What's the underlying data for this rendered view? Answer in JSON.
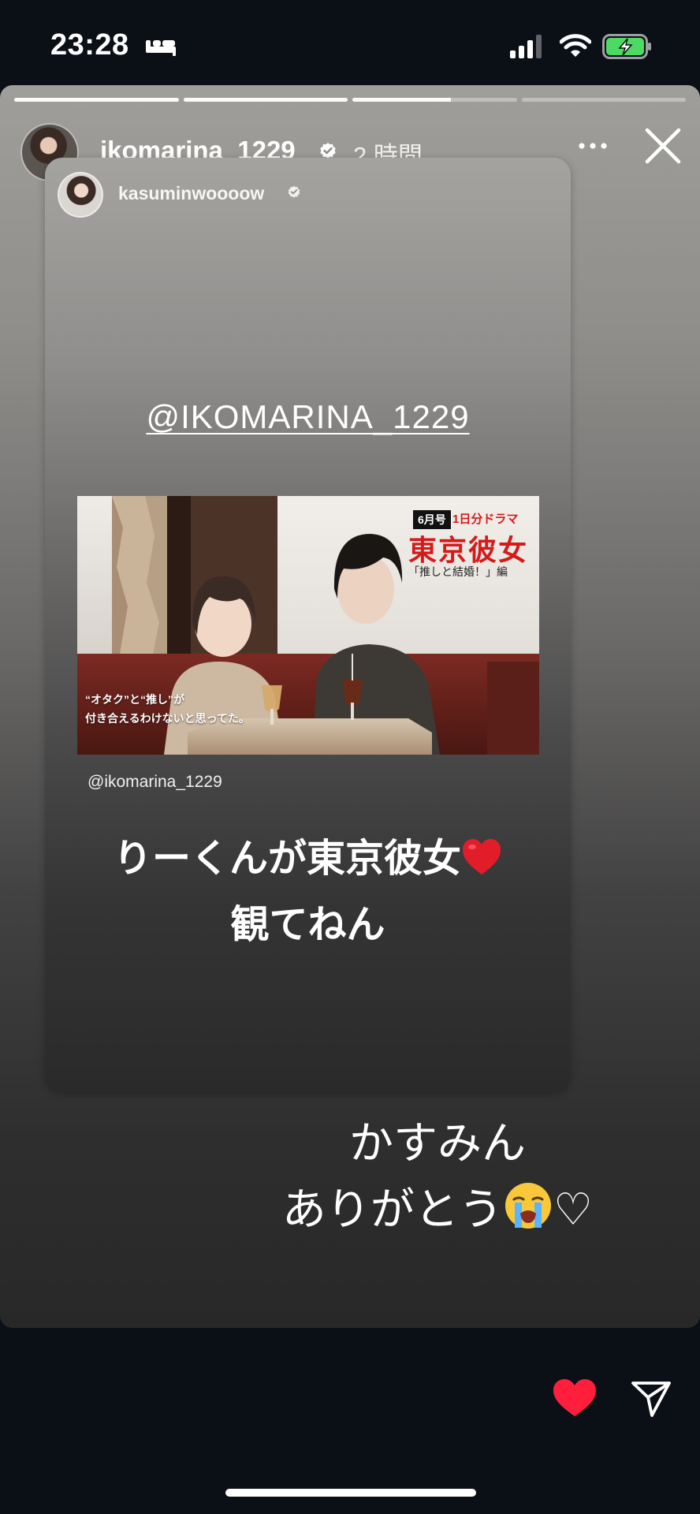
{
  "status_bar": {
    "time": "23:28",
    "sleep_icon": "bed-icon",
    "signal_icon": "cellular-signal-icon",
    "wifi_icon": "wifi-icon",
    "battery_icon": "battery-charging-icon",
    "battery_color": "#4cd964"
  },
  "story": {
    "progress": [
      1.0,
      1.0,
      0.6,
      0.0
    ],
    "username": "ikomarina_1229",
    "time_ago": "2 時間",
    "more_icon": "more-horizontal-icon",
    "close_icon": "close-icon",
    "shared_post": {
      "username": "kasuminwoooow",
      "mention": "@IKOMARINA_1229",
      "promo": {
        "badge": "6月号",
        "series": "1日分ドラマ",
        "title": "東京彼女",
        "subtitle": "「推しと結婚！」編",
        "tagline_line1": "“オタク”と“推し”が",
        "tagline_line2": "付き合えるわけないと思ってた。"
      },
      "mention_small": "@ikomarina_1229",
      "caption_line1": "りーくんが東京彼女",
      "caption_line2": "観てねん"
    },
    "reply_line1": "かすみん",
    "reply_line2": "ありがとう",
    "reply_emoji": "loudly-crying-face",
    "reply_heart": "♡"
  },
  "actions": {
    "like_icon": "heart-icon",
    "like_color": "#ff1f3d",
    "send_icon": "send-icon"
  }
}
